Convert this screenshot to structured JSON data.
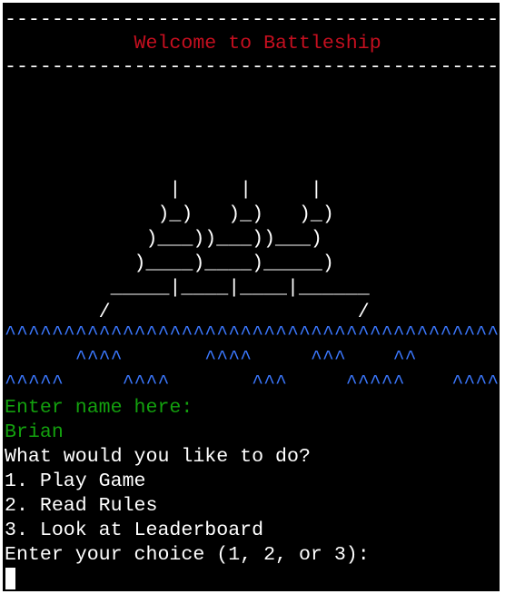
{
  "colors": {
    "background": "#000000",
    "text": "#ffffff",
    "title": "#c50f1f",
    "ascii_art": "#ffffff",
    "waves": "#3b78ff",
    "prompt_name": "#13a10e"
  },
  "header": {
    "rule_top": "--------------------------------------------",
    "title": "           Welcome to Battleship",
    "rule_bottom": "--------------------------------------------"
  },
  "ship_art": [
    "              |     |     |",
    "             )_)   )_)   )_)",
    "            )___))___))___)",
    "           )____)____)_____)",
    "         _____|____|____|______",
    "        /                     /"
  ],
  "waves": [
    "^^^^^^^^^^^^^^^^^^^^^^^^^^^^^^^^^^^^^^^^^^^^",
    "      ^^^^       ^^^^     ^^^    ^^",
    "^^^^^     ^^^^       ^^^     ^^^^^    ^^^^"
  ],
  "console": {
    "name_prompt": "Enter name here:",
    "name_value": "Brian",
    "menu_question": "What would you like to do?",
    "option_1": "1. Play Game",
    "option_2": "2. Read Rules",
    "option_3": "3. Look at Leaderboard",
    "choice_prompt": "Enter your choice (1, 2, or 3):"
  }
}
